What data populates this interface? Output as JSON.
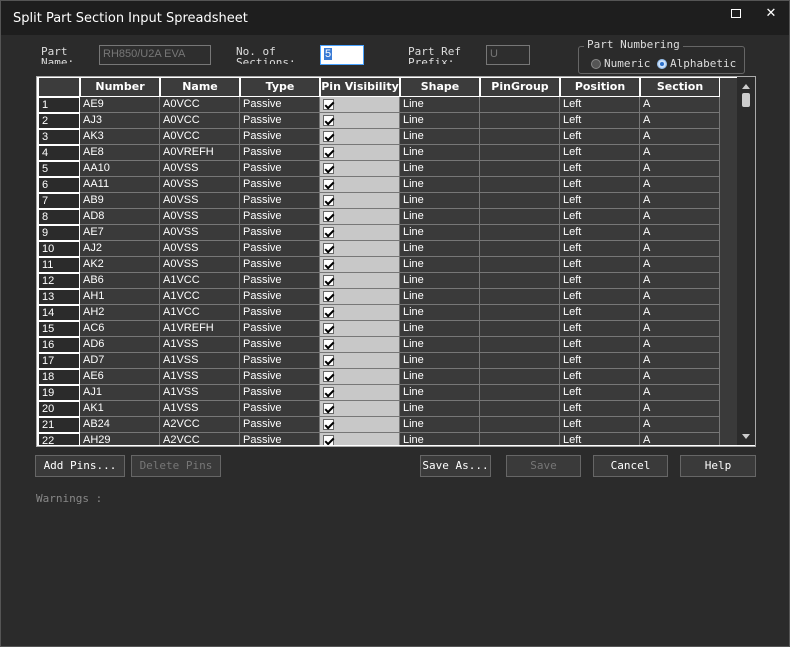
{
  "window": {
    "title": "Split Part Section Input Spreadsheet",
    "maximize_icon": "maximize-icon",
    "close_glyph": "✕"
  },
  "form": {
    "part_name_label_1": "Part",
    "part_name_label_2": "Name:",
    "part_name_value": "RH850/U2A EVA",
    "sections_label_1": "No. of",
    "sections_label_2": "Sections:",
    "sections_value": "5",
    "prefix_label_1": "Part Ref",
    "prefix_label_2": "Prefix:",
    "prefix_value": "U",
    "numbering_title": "Part Numbering",
    "numeric_label": "Numeric",
    "alphabetic_label": "Alphabetic",
    "numbering_selected": "Alphabetic"
  },
  "table": {
    "columns": [
      "",
      "Number",
      "Name",
      "Type",
      "Pin Visibility",
      "Shape",
      "PinGroup",
      "Position",
      "Section"
    ],
    "rows": [
      [
        "1",
        "AE9",
        "A0VCC",
        "Passive",
        true,
        "Line",
        "",
        "Left",
        "A"
      ],
      [
        "2",
        "AJ3",
        "A0VCC",
        "Passive",
        true,
        "Line",
        "",
        "Left",
        "A"
      ],
      [
        "3",
        "AK3",
        "A0VCC",
        "Passive",
        true,
        "Line",
        "",
        "Left",
        "A"
      ],
      [
        "4",
        "AE8",
        "A0VREFH",
        "Passive",
        true,
        "Line",
        "",
        "Left",
        "A"
      ],
      [
        "5",
        "AA10",
        "A0VSS",
        "Passive",
        true,
        "Line",
        "",
        "Left",
        "A"
      ],
      [
        "6",
        "AA11",
        "A0VSS",
        "Passive",
        true,
        "Line",
        "",
        "Left",
        "A"
      ],
      [
        "7",
        "AB9",
        "A0VSS",
        "Passive",
        true,
        "Line",
        "",
        "Left",
        "A"
      ],
      [
        "8",
        "AD8",
        "A0VSS",
        "Passive",
        true,
        "Line",
        "",
        "Left",
        "A"
      ],
      [
        "9",
        "AE7",
        "A0VSS",
        "Passive",
        true,
        "Line",
        "",
        "Left",
        "A"
      ],
      [
        "10",
        "AJ2",
        "A0VSS",
        "Passive",
        true,
        "Line",
        "",
        "Left",
        "A"
      ],
      [
        "11",
        "AK2",
        "A0VSS",
        "Passive",
        true,
        "Line",
        "",
        "Left",
        "A"
      ],
      [
        "12",
        "AB6",
        "A1VCC",
        "Passive",
        true,
        "Line",
        "",
        "Left",
        "A"
      ],
      [
        "13",
        "AH1",
        "A1VCC",
        "Passive",
        true,
        "Line",
        "",
        "Left",
        "A"
      ],
      [
        "14",
        "AH2",
        "A1VCC",
        "Passive",
        true,
        "Line",
        "",
        "Left",
        "A"
      ],
      [
        "15",
        "AC6",
        "A1VREFH",
        "Passive",
        true,
        "Line",
        "",
        "Left",
        "A"
      ],
      [
        "16",
        "AD6",
        "A1VSS",
        "Passive",
        true,
        "Line",
        "",
        "Left",
        "A"
      ],
      [
        "17",
        "AD7",
        "A1VSS",
        "Passive",
        true,
        "Line",
        "",
        "Left",
        "A"
      ],
      [
        "18",
        "AE6",
        "A1VSS",
        "Passive",
        true,
        "Line",
        "",
        "Left",
        "A"
      ],
      [
        "19",
        "AJ1",
        "A1VSS",
        "Passive",
        true,
        "Line",
        "",
        "Left",
        "A"
      ],
      [
        "20",
        "AK1",
        "A1VSS",
        "Passive",
        true,
        "Line",
        "",
        "Left",
        "A"
      ],
      [
        "21",
        "AB24",
        "A2VCC",
        "Passive",
        true,
        "Line",
        "",
        "Left",
        "A"
      ],
      [
        "22",
        "AH29",
        "A2VCC",
        "Passive",
        true,
        "Line",
        "",
        "Left",
        "A"
      ]
    ]
  },
  "buttons": {
    "add_pins": "Add Pins...",
    "delete_pins": "Delete Pins",
    "save_as": "Save As...",
    "save": "Save",
    "cancel": "Cancel",
    "help": "Help"
  },
  "warnings_label": "Warnings :",
  "colors": {
    "accent": "#2b6fc9",
    "background": "#2b2b2b",
    "pin_visibility_cell": "#c8c8c8"
  }
}
